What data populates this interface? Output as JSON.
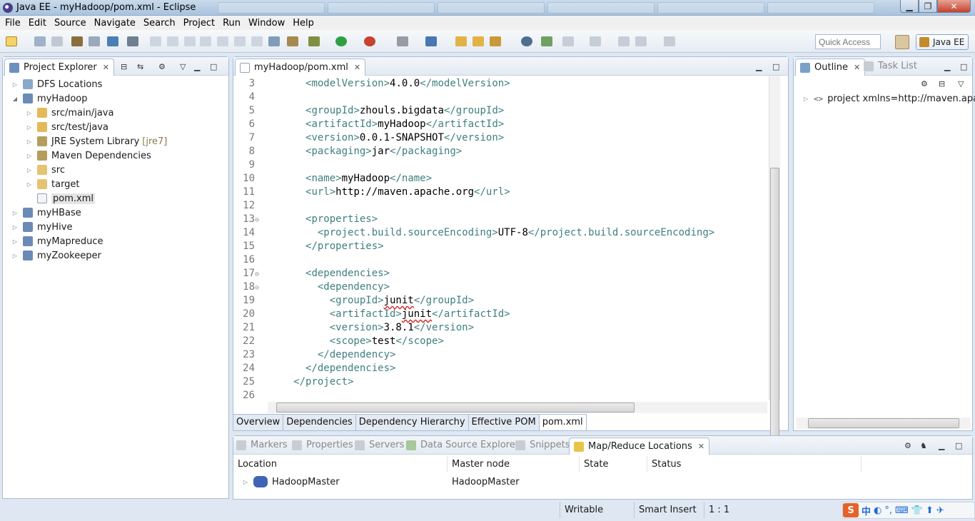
{
  "window": {
    "title": "Java EE - myHadoop/pom.xml - Eclipse",
    "min": "▁",
    "max": "❐",
    "close": "✕"
  },
  "menu": [
    "File",
    "Edit",
    "Source",
    "Navigate",
    "Search",
    "Project",
    "Run",
    "Window",
    "Help"
  ],
  "toolbar": {
    "quick_access_placeholder": "Quick Access",
    "perspective": "Java EE"
  },
  "project_explorer": {
    "tab_label": "Project Explorer",
    "items": [
      {
        "label": "DFS Locations",
        "extra": "",
        "depth": 0,
        "expanded": false,
        "icon": "dfs-icon"
      },
      {
        "label": "myHadoop",
        "extra": "",
        "depth": 0,
        "expanded": true,
        "icon": "project-icon"
      },
      {
        "label": "src/main/java",
        "extra": "",
        "depth": 1,
        "expanded": false,
        "icon": "package-folder-icon"
      },
      {
        "label": "src/test/java",
        "extra": "",
        "depth": 1,
        "expanded": false,
        "icon": "package-folder-icon"
      },
      {
        "label": "JRE System Library",
        "extra": "[jre7]",
        "depth": 1,
        "expanded": false,
        "icon": "library-icon"
      },
      {
        "label": "Maven Dependencies",
        "extra": "",
        "depth": 1,
        "expanded": false,
        "icon": "library-icon"
      },
      {
        "label": "src",
        "extra": "",
        "depth": 1,
        "expanded": false,
        "icon": "folder-icon"
      },
      {
        "label": "target",
        "extra": "",
        "depth": 1,
        "expanded": false,
        "icon": "folder-icon"
      },
      {
        "label": "pom.xml",
        "extra": "",
        "depth": 1,
        "expanded": null,
        "icon": "xml-file-icon"
      },
      {
        "label": "myHBase",
        "extra": "",
        "depth": 0,
        "expanded": false,
        "icon": "project-icon"
      },
      {
        "label": "myHive",
        "extra": "",
        "depth": 0,
        "expanded": false,
        "icon": "project-icon"
      },
      {
        "label": "myMapreduce",
        "extra": "",
        "depth": 0,
        "expanded": false,
        "icon": "project-icon"
      },
      {
        "label": "myZookeeper",
        "extra": "",
        "depth": 0,
        "expanded": false,
        "icon": "project-icon"
      }
    ]
  },
  "editor": {
    "tab_label": "myHadoop/pom.xml",
    "lines": [
      {
        "n": "3",
        "fold": "",
        "indent": "  ",
        "parts": [
          [
            "t",
            "<modelVersion>"
          ],
          [
            "v",
            "4.0.0"
          ],
          [
            "t",
            "</modelVersion>"
          ]
        ]
      },
      {
        "n": "4",
        "fold": "",
        "indent": "",
        "parts": []
      },
      {
        "n": "5",
        "fold": "",
        "indent": "  ",
        "parts": [
          [
            "t",
            "<groupId>"
          ],
          [
            "v",
            "zhouls.bigdata"
          ],
          [
            "t",
            "</groupId>"
          ]
        ]
      },
      {
        "n": "6",
        "fold": "",
        "indent": "  ",
        "parts": [
          [
            "t",
            "<artifactId>"
          ],
          [
            "v",
            "myHadoop"
          ],
          [
            "t",
            "</artifactId>"
          ]
        ]
      },
      {
        "n": "7",
        "fold": "",
        "indent": "  ",
        "parts": [
          [
            "t",
            "<version>"
          ],
          [
            "v",
            "0.0.1-SNAPSHOT"
          ],
          [
            "t",
            "</version>"
          ]
        ]
      },
      {
        "n": "8",
        "fold": "",
        "indent": "  ",
        "parts": [
          [
            "t",
            "<packaging>"
          ],
          [
            "v",
            "jar"
          ],
          [
            "t",
            "</packaging>"
          ]
        ]
      },
      {
        "n": "9",
        "fold": "",
        "indent": "",
        "parts": []
      },
      {
        "n": "10",
        "fold": "",
        "indent": "  ",
        "parts": [
          [
            "t",
            "<name>"
          ],
          [
            "v",
            "myHadoop"
          ],
          [
            "t",
            "</name>"
          ]
        ]
      },
      {
        "n": "11",
        "fold": "",
        "indent": "  ",
        "parts": [
          [
            "t",
            "<url>"
          ],
          [
            "v",
            "http://maven.apache.org"
          ],
          [
            "t",
            "</url>"
          ]
        ]
      },
      {
        "n": "12",
        "fold": "",
        "indent": "",
        "parts": []
      },
      {
        "n": "13",
        "fold": "⊖",
        "indent": "  ",
        "parts": [
          [
            "t",
            "<properties>"
          ]
        ]
      },
      {
        "n": "14",
        "fold": "",
        "indent": "    ",
        "parts": [
          [
            "t",
            "<project.build.sourceEncoding>"
          ],
          [
            "v",
            "UTF-8"
          ],
          [
            "t",
            "</project.build.sourceEncoding>"
          ]
        ]
      },
      {
        "n": "15",
        "fold": "",
        "indent": "  ",
        "parts": [
          [
            "t",
            "</properties>"
          ]
        ]
      },
      {
        "n": "16",
        "fold": "",
        "indent": "",
        "parts": []
      },
      {
        "n": "17",
        "fold": "⊖",
        "indent": "  ",
        "parts": [
          [
            "t",
            "<dependencies>"
          ]
        ]
      },
      {
        "n": "18",
        "fold": "⊖",
        "indent": "    ",
        "parts": [
          [
            "t",
            "<dependency>"
          ]
        ]
      },
      {
        "n": "19",
        "fold": "",
        "indent": "      ",
        "parts": [
          [
            "t",
            "<groupId>"
          ],
          [
            "s",
            "junit"
          ],
          [
            "t",
            "</groupId>"
          ]
        ]
      },
      {
        "n": "20",
        "fold": "",
        "indent": "      ",
        "parts": [
          [
            "t",
            "<artifactId>"
          ],
          [
            "s",
            "junit"
          ],
          [
            "t",
            "</artifactId>"
          ]
        ]
      },
      {
        "n": "21",
        "fold": "",
        "indent": "      ",
        "parts": [
          [
            "t",
            "<version>"
          ],
          [
            "v",
            "3.8.1"
          ],
          [
            "t",
            "</version>"
          ]
        ]
      },
      {
        "n": "22",
        "fold": "",
        "indent": "      ",
        "parts": [
          [
            "t",
            "<scope>"
          ],
          [
            "v",
            "test"
          ],
          [
            "t",
            "</scope>"
          ]
        ]
      },
      {
        "n": "23",
        "fold": "",
        "indent": "    ",
        "parts": [
          [
            "t",
            "</dependency>"
          ]
        ]
      },
      {
        "n": "24",
        "fold": "",
        "indent": "  ",
        "parts": [
          [
            "t",
            "</dependencies>"
          ]
        ]
      },
      {
        "n": "25",
        "fold": "",
        "indent": "",
        "parts": [
          [
            "t",
            "</project>"
          ]
        ]
      },
      {
        "n": "26",
        "fold": "",
        "indent": "",
        "parts": []
      }
    ],
    "bottom_tabs": [
      "Overview",
      "Dependencies",
      "Dependency Hierarchy",
      "Effective POM",
      "pom.xml"
    ],
    "active_bottom_tab": 4
  },
  "outline": {
    "tab_label": "Outline",
    "tasklist_label": "Task List",
    "item": "project xmlns=http://maven.apache"
  },
  "bottom_panel": {
    "tabs": [
      "Markers",
      "Properties",
      "Servers",
      "Data Source Explorer",
      "Snippets",
      "Map/Reduce Locations"
    ],
    "active_tab": 5,
    "columns": [
      "Location",
      "Master node",
      "State",
      "Status"
    ],
    "rows": [
      {
        "location": "HadoopMaster",
        "master_node": "HadoopMaster",
        "state": "",
        "status": ""
      }
    ]
  },
  "statusbar": {
    "writable": "Writable",
    "insert_mode": "Smart Insert",
    "position": "1 : 1",
    "ime_label": "中"
  },
  "colors": {
    "xml_tag": "#3f7f7f",
    "line_number": "#787878",
    "accent": "#a9bcd3"
  }
}
